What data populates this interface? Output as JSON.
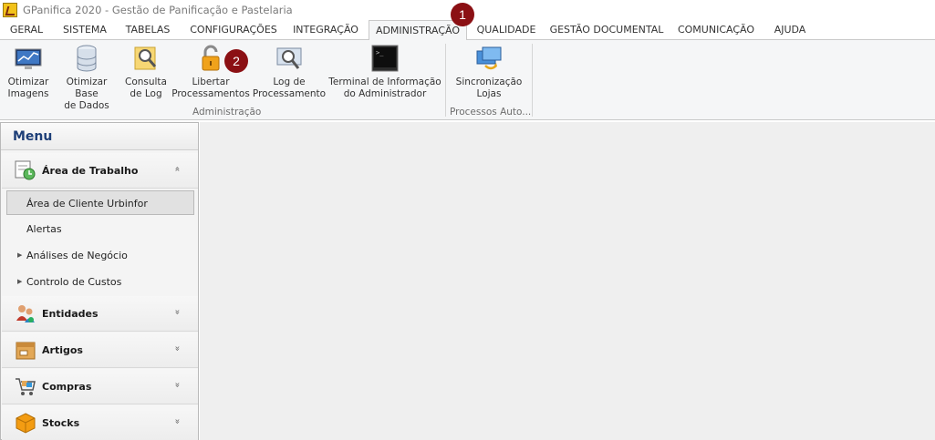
{
  "window": {
    "title": "GPanifica 2020 - Gestão de Panificação e Pastelaria"
  },
  "tabs": [
    {
      "label": "GERAL"
    },
    {
      "label": "SISTEMA"
    },
    {
      "label": "TABELAS"
    },
    {
      "label": "CONFIGURAÇÕES"
    },
    {
      "label": "INTEGRAÇÃO"
    },
    {
      "label": "ADMINISTRAÇÃO",
      "active": true
    },
    {
      "label": "QUALIDADE"
    },
    {
      "label": "GESTÃO DOCUMENTAL"
    },
    {
      "label": "COMUNICAÇÃO"
    },
    {
      "label": "AJUDA"
    }
  ],
  "ribbon": {
    "buttons": [
      {
        "line1": "Otimizar",
        "line2": "Imagens",
        "icon": "chart-monitor-icon"
      },
      {
        "line1": "Otimizar Base",
        "line2": "de Dados",
        "icon": "database-icon"
      },
      {
        "line1": "Consulta",
        "line2": "de Log",
        "icon": "log-search-icon"
      },
      {
        "line1": "Libertar",
        "line2": "Processamentos",
        "icon": "padlock-icon"
      },
      {
        "line1": "Log de",
        "line2": "Processamento",
        "icon": "monitor-search-icon"
      },
      {
        "line1": "Terminal de Informação",
        "line2": "do Administrador",
        "icon": "terminal-icon"
      },
      {
        "line1": "Sincronização",
        "line2": "Lojas",
        "icon": "sync-stores-icon"
      }
    ],
    "groups": [
      {
        "label": "Administração"
      },
      {
        "label": "Processos Auto..."
      }
    ]
  },
  "badges": [
    "1",
    "2"
  ],
  "sidebar": {
    "title": "Menu",
    "groups": [
      {
        "label": "Área de Trabalho",
        "icon": "workspace-clock-icon",
        "expanded": true
      },
      {
        "label": "Entidades",
        "icon": "people-icon"
      },
      {
        "label": "Artigos",
        "icon": "box-icon"
      },
      {
        "label": "Compras",
        "icon": "cart-icon"
      },
      {
        "label": "Stocks",
        "icon": "cube-icon"
      }
    ],
    "items": [
      {
        "label": "Área de Cliente Urbinfor",
        "selected": true
      },
      {
        "label": "Alertas"
      },
      {
        "label": "Análises de Negócio",
        "expandable": true
      },
      {
        "label": "Controlo de Custos",
        "expandable": true
      }
    ],
    "collapse_glyph": "«",
    "expand_glyph": "»"
  },
  "colors": {
    "accent": "#1e3f78",
    "badge": "#8b1014"
  }
}
